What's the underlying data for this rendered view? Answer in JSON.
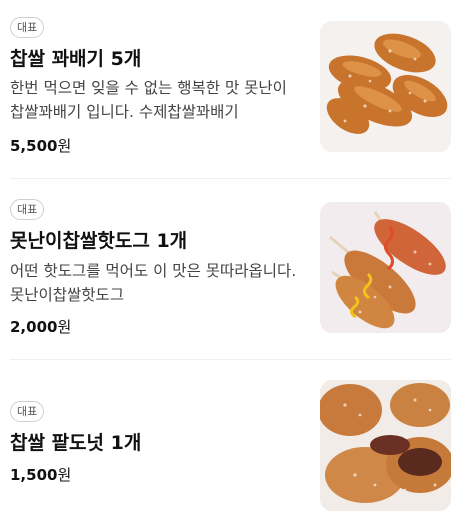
{
  "menu": {
    "items": [
      {
        "badge": "대표",
        "name": "찹쌀 꽈배기 5개",
        "description": "한번 먹으면 잊을 수 없는 행복한 맛 못난이찹쌀꽈배기 입니다. 수제찹쌀꽈배기",
        "price": "5,500",
        "currency": "원",
        "image_icon": "twisted-donut-icon"
      },
      {
        "badge": "대표",
        "name": "못난이찹쌀핫도그 1개",
        "description": "어떤 핫도그를 먹어도 이 맛은 못따라옵니다. 못난이찹쌀핫도그",
        "price": "2,000",
        "currency": "원",
        "image_icon": "hotdog-icon"
      },
      {
        "badge": "대표",
        "name": "찹쌀 팥도넛 1개",
        "description": "",
        "price": "1,500",
        "currency": "원",
        "image_icon": "red-bean-donut-icon"
      }
    ]
  },
  "colors": {
    "text_primary": "#111111",
    "text_secondary": "#444444",
    "badge_border": "#cfcfcf",
    "divider": "#efefef",
    "thumbnail_bg": "#f4f0ee"
  }
}
